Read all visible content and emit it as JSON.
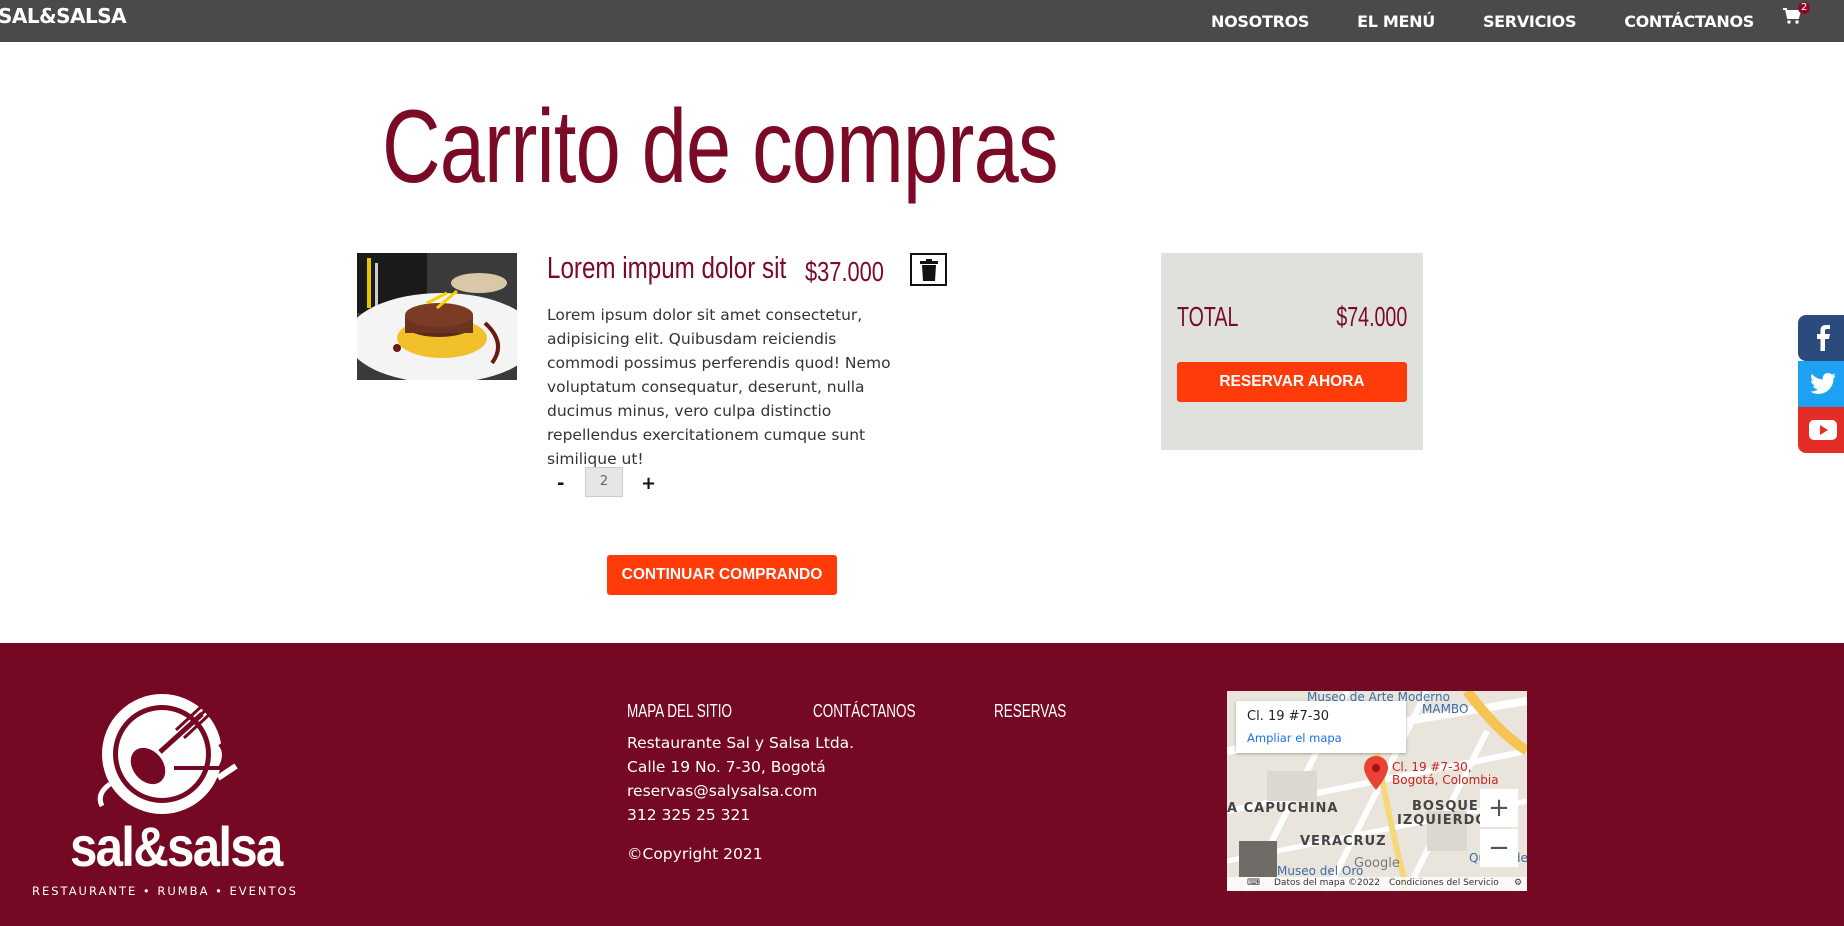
{
  "nav": {
    "brand": "SAL&SALSA",
    "links": [
      "NOSOTROS",
      "EL MENÚ",
      "SERVICIOS",
      "CONTÁCTANOS"
    ],
    "cart_count": "2"
  },
  "page": {
    "title": "Carrito de compras"
  },
  "cart_item": {
    "name": "Lorem impum dolor sit",
    "price": "$37.000",
    "description": "Lorem ipsum dolor sit amet consectetur, adipisicing elit. Quibusdam reiciendis commodi possimus perferendis quod! Nemo voluptatum consequatur, deserunt, nulla ducimus minus, vero culpa distinctio repellendus exercitationem cumque sunt similique ut!",
    "qty_minus": "-",
    "quantity": "2",
    "qty_plus": "+"
  },
  "actions": {
    "continue_label": "CONTINUAR COMPRANDO"
  },
  "summary": {
    "total_label": "TOTAL",
    "total_value": "$74.000",
    "reserve_label": "RESERVAR AHORA"
  },
  "social": {
    "icons": [
      "facebook-icon",
      "twitter-icon",
      "youtube-icon"
    ],
    "colors": [
      "#2d4a7c",
      "#1da1f2",
      "#e52d27"
    ]
  },
  "footer": {
    "logo_text": "sal&salsa",
    "logo_tagline": "RESTAURANTE • RUMBA • EVENTOS",
    "headings": [
      "MAPA DEL SITIO",
      "CONTÁCTANOS",
      "RESERVAS"
    ],
    "company": "Restaurante Sal y Salsa Ltda.",
    "address": "Calle 19 No. 7-30, Bogotá",
    "email": "reservas@salysalsa.com",
    "phone": "312 325 25 321",
    "copyright": "©Copyright 2021"
  },
  "map": {
    "card_title": "Cl. 19 #7-30",
    "card_link": "Ampliar el mapa",
    "pin_label_line1": "Cl. 19 #7-30,",
    "pin_label_line2": "Bogotá, Colombia",
    "labels": [
      "Museo de Arte Moderno",
      "MAMBO",
      "A CAPUCHINA",
      "BOSQUE",
      "IZQUIERDO",
      "VERACRUZ",
      "Museo del Oro",
      "Quinta de"
    ],
    "zoom_in": "+",
    "zoom_out": "−",
    "attribution": "Datos del mapa ©2022",
    "terms": "Condiciones del Servicio",
    "google": "Google"
  },
  "colors": {
    "nav_bg": "#4a4a4a",
    "brand_red": "#7a0a26",
    "footer_bg": "#750822",
    "accent_orange": "#ff3b0a",
    "summary_bg": "#e0e0dc"
  }
}
